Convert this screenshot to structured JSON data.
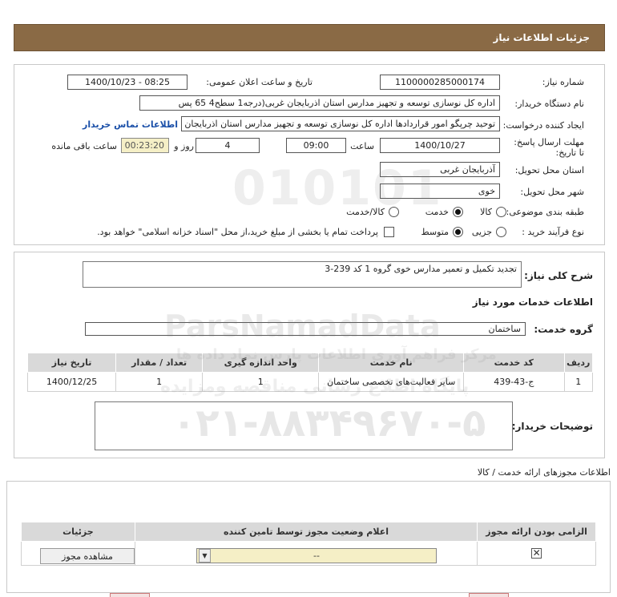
{
  "header": {
    "title": "جزئیات اطلاعات نیاز"
  },
  "details": {
    "need_number_label": "شماره نیاز:",
    "need_number": "1100000285000174",
    "announce_label": "تاریخ و ساعت اعلان عمومی:",
    "announce_value": "1400/10/23 - 08:25",
    "buyer_org_label": "نام دستگاه خریدار:",
    "buyer_org": "اداره کل نوسازی   توسعه و تجهیز مدارس استان اذربایجان غربی(درجه1  سطح4  65 پس",
    "requester_label": "ایجاد کننده درخواست:",
    "requester": "توحید چرپگو امور قراردادها اداره کل نوسازی   توسعه و تجهیز مدارس استان اذربایجان غربی",
    "contact_link": "اطلاعات تماس خریدار",
    "deadline_label": "مهلت ارسال پاسخ: تا تاریخ:",
    "deadline_date": "1400/10/27",
    "time_label": "ساعت",
    "deadline_time": "09:00",
    "days_value": "4",
    "days_label": "روز و",
    "remaining_time": "00:23:20",
    "remaining_label": "ساعت باقی مانده",
    "province_label": "استان محل تحویل:",
    "province": "آذربایجان غربی",
    "city_label": "شهر محل تحویل:",
    "city": "خوی",
    "category_label": "طبقه بندی موضوعی:",
    "category_options": [
      "کالا",
      "خدمت",
      "کالا/خدمت"
    ],
    "process_label": "نوع فرآیند خرید :",
    "process_options": [
      "جزیی",
      "متوسط"
    ],
    "payment_note": "پرداخت تمام یا بخشی از مبلغ خرید،از محل \"اسناد خزانه اسلامی\" خواهد بود."
  },
  "need": {
    "summary_label": "شرح کلی نیاز:",
    "summary": "تجدید تکمیل و تعمیر مدارس خوی گروه 1 کد 239-3",
    "services_heading": "اطلاعات خدمات مورد نیاز",
    "service_group_label": "گروه خدمت:",
    "service_group": "ساختمان",
    "table": {
      "headers": [
        "ردیف",
        "کد خدمت",
        "نام خدمت",
        "واحد اندازه گیری",
        "تعداد / مقدار",
        "تاریخ نیاز"
      ],
      "rows": [
        [
          "1",
          "ج-43-439",
          "سایر فعالیت‌های تخصصی ساختمان",
          "1",
          "1",
          "1400/12/25"
        ]
      ]
    },
    "buyer_notes_label": "توضیحات خریدار:"
  },
  "permits": {
    "heading": "اطلاعات مجوزهای ارائه خدمت / کالا",
    "headers": [
      "الزامی بودن ارائه مجوز",
      "اعلام وضعیت مجوز توسط تامین کننده",
      "جزئیات"
    ],
    "status_value": "--",
    "view_button": "مشاهده مجوز"
  },
  "watermark": {
    "line1": "ParsNamadData",
    "line2": "مرکز فراهم آوری اطلاعات پارس نماد داده ها",
    "line3": "پایگاه اطلاع رسانی مناقصه ومزایده",
    "phone": "۰۲۱-۸۸۳۴۹۶۷۰-۵"
  },
  "colors": {
    "header_bg": "#8a6a45",
    "link": "#1a4fa8",
    "timer_bg": "#f5efc6"
  }
}
